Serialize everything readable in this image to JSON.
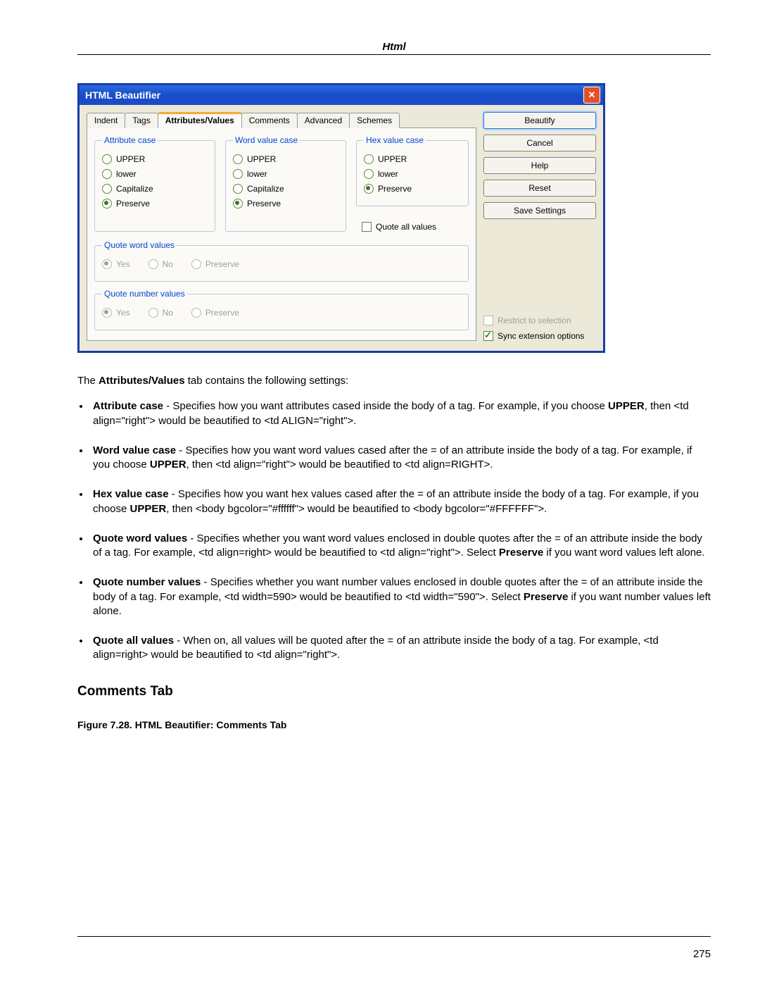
{
  "header": "Html",
  "dialog": {
    "title": "HTML Beautifier",
    "tabs": [
      "Indent",
      "Tags",
      "Attributes/Values",
      "Comments",
      "Advanced",
      "Schemes"
    ],
    "active_tab": 2,
    "groups": {
      "attr_case": {
        "legend": "Attribute case",
        "options": [
          "UPPER",
          "lower",
          "Capitalize",
          "Preserve"
        ],
        "selected": 3
      },
      "word_case": {
        "legend": "Word value case",
        "options": [
          "UPPER",
          "lower",
          "Capitalize",
          "Preserve"
        ],
        "selected": 3
      },
      "hex_case": {
        "legend": "Hex value case",
        "options": [
          "UPPER",
          "lower",
          "Preserve"
        ],
        "selected": 2
      },
      "quote_word": {
        "legend": "Quote word values",
        "options": [
          "Yes",
          "No",
          "Preserve"
        ],
        "selected": 0,
        "disabled": true
      },
      "quote_num": {
        "legend": "Quote number values",
        "options": [
          "Yes",
          "No",
          "Preserve"
        ],
        "selected": 0,
        "disabled": true
      }
    },
    "quote_all_label": "Quote all values",
    "buttons": [
      "Beautify",
      "Cancel",
      "Help",
      "Reset",
      "Save Settings"
    ],
    "restrict_label": "Restrict to selection",
    "sync_label": "Sync extension options"
  },
  "intro_prefix": "The ",
  "intro_bold": "Attributes/Values",
  "intro_suffix": " tab contains the following settings:",
  "bullets": [
    {
      "b": "Attribute case",
      "t1": " - Specifies how you want attributes cased inside the body of a tag. For example, if you choose ",
      "b2": "UPPER",
      "t2": ", then <td align=\"right\"> would be beautified to <td ALIGN=\"right\">."
    },
    {
      "b": "Word value case",
      "t1": " - Specifies how you want word values cased after the = of an attribute inside the body of a tag. For example, if you choose ",
      "b2": "UPPER",
      "t2": ", then <td align=\"right\"> would be beautified to <td align=RIGHT>."
    },
    {
      "b": "Hex value case",
      "t1": " - Specifies how you want hex values cased after the = of an attribute inside the body of a tag. For example, if you choose ",
      "b2": "UPPER",
      "t2": ", then <body bgcolor=\"#ffffff\"> would be beautified to <body bgcolor=\"#FFFFFF\">."
    },
    {
      "b": "Quote word values",
      "t1": " - Specifies whether you want word values enclosed in double quotes after the = of an attribute inside the body of a tag. For example, <td align=right> would be beautified to <td align=\"right\">. Select ",
      "b2": "Preserve",
      "t2": " if you want word values left alone."
    },
    {
      "b": "Quote number values",
      "t1": " - Specifies whether you want number values enclosed in double quotes after the = of an attribute inside the body of a tag. For example, <td width=590> would be beautified to <td width=\"590\">. Select ",
      "b2": "Preserve",
      "t2": " if you want number values left alone."
    },
    {
      "b": "Quote all values",
      "t1": " - When on, all values will be quoted after the = of an attribute inside the body of a tag. For example, <td align=right> would be beautified to <td align=\"right\">.",
      "b2": "",
      "t2": ""
    }
  ],
  "section_heading": "Comments Tab",
  "figure_caption": "Figure 7.28. HTML Beautifier: Comments Tab",
  "page_number": "275"
}
